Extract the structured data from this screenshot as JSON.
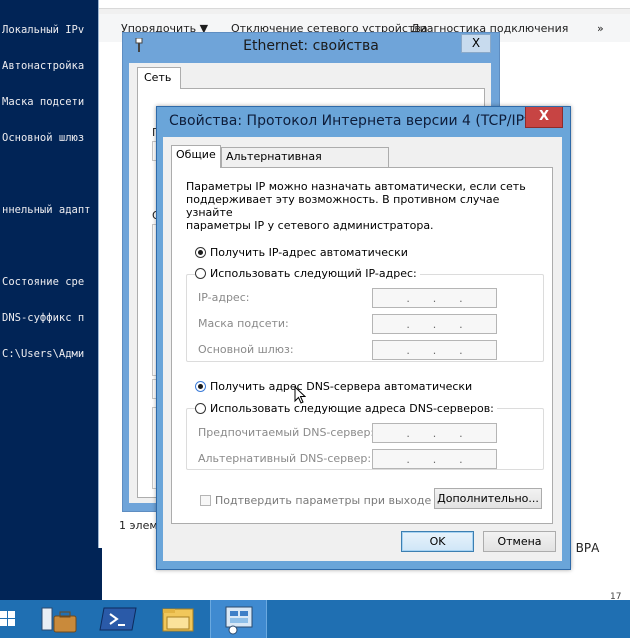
{
  "console": {
    "lines": [
      "Локальный IPv",
      "Автонастройка",
      "Маска подсети",
      "Основной шлюз",
      "",
      "ннельный адапт",
      "",
      "Состояние сре",
      "DNS-суффикс п",
      "C:\\Users\\Адми"
    ]
  },
  "network_window": {
    "toolbar": [
      "Упорядочить ▼",
      "Отключение сетевого устройства",
      "Диагностика подключения",
      "»"
    ],
    "status_text": "1 элем",
    "right_text": "аты ВРА",
    "corner_number": "17"
  },
  "ethernet_dialog": {
    "title": "Ethernet: свойства",
    "close": "X",
    "tab": "Сеть",
    "fragments": [
      "П",
      "О"
    ]
  },
  "ipv4_dialog": {
    "title": "Свойства: Протокол Интернета версии 4 (TCP/IPv4)",
    "close": "X",
    "tabs": [
      "Общие",
      "Альтернативная конфигурация"
    ],
    "intro": "Параметры IP можно назначать автоматически, если сеть\nподдерживает эту возможность. В противном случае узнайте\nпараметры IP у сетевого администратора.",
    "ip_auto": "Получить IP-адрес автоматически",
    "ip_manual": "Использовать следующий IP-адрес:",
    "ip_fields": [
      "IP-адрес:",
      "Маска подсети:",
      "Основной шлюз:"
    ],
    "dns_auto": "Получить адрес DNS-сервера автоматически",
    "dns_manual": "Использовать следующие адреса DNS-серверов:",
    "dns_fields": [
      "Предпочитаемый DNS-сервер:",
      "Альтернативный DNS-сервер:"
    ],
    "ip_placeholder_dots": [
      ".",
      ".",
      "."
    ],
    "validate_checkbox": "Подтвердить параметры при выходе",
    "advanced_button": "Дополнительно...",
    "ok_button": "OK",
    "cancel_button": "Отмена",
    "ip_mode": "auto",
    "dns_mode": "auto",
    "validate_checked": false
  },
  "taskbar": {
    "items": [
      "start-icon",
      "server-manager-icon",
      "powershell-icon",
      "file-explorer-icon",
      "network-control-panel-icon"
    ],
    "active_index": 4
  },
  "colors": {
    "console_bg": "#012456",
    "dialog_frame": "#6aa5d9",
    "close_red": "#c74443",
    "taskbar": "#1f6fb2"
  }
}
